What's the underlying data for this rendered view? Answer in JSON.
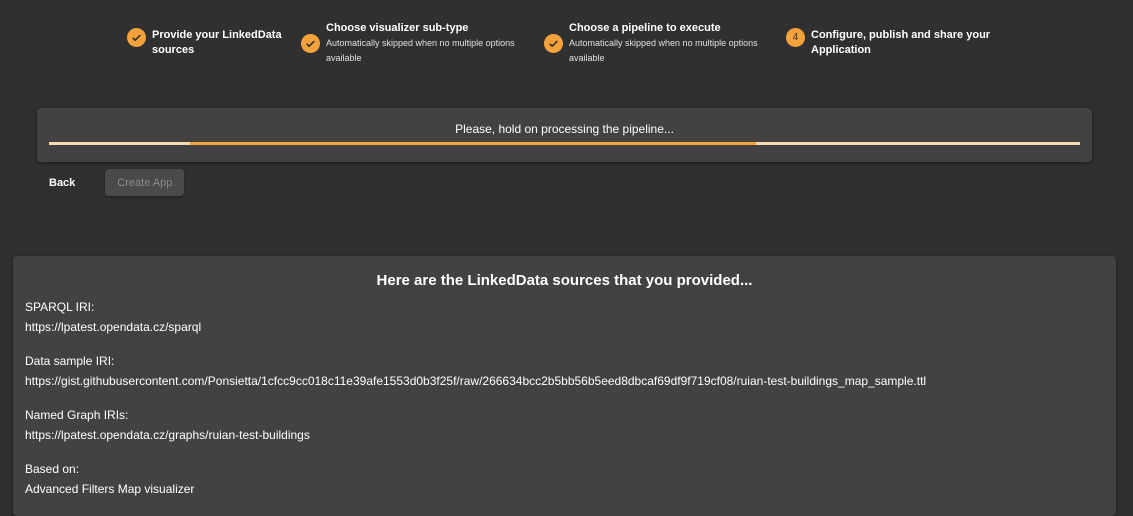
{
  "stepper": {
    "steps": [
      {
        "icon": "check-icon",
        "title_line1": "Provide your LinkedData",
        "title_line2": "sources",
        "sub_line1": "",
        "sub_line2": ""
      },
      {
        "icon": "check-icon",
        "title_line1": "Choose visualizer sub-type",
        "title_line2": "",
        "sub_line1": "Automatically skipped when no multiple options",
        "sub_line2": "available"
      },
      {
        "icon": "check-icon",
        "title_line1": "Choose a pipeline to execute",
        "title_line2": "",
        "sub_line1": "Automatically skipped when no multiple options",
        "sub_line2": "available"
      },
      {
        "icon": "step-number",
        "number": "4",
        "title_line1": "Configure, publish and share your",
        "title_line2": "Application",
        "sub_line1": "",
        "sub_line2": ""
      }
    ]
  },
  "progress": {
    "label": "Please, hold on processing the pipeline...",
    "indeterminate": true,
    "bar_start": 0.137,
    "bar_end": 0.686
  },
  "actions": {
    "back_label": "Back",
    "create_label": "Create App",
    "create_disabled": true
  },
  "sources": {
    "title": "Here are the LinkedData sources that you provided...",
    "fields": [
      {
        "label": "SPARQL IRI:",
        "value": "https://lpatest.opendata.cz/sparql"
      },
      {
        "label": "Data sample IRI:",
        "value": "https://gist.githubusercontent.com/Ponsietta/1cfcc9cc018c11e39afe1553d0b3f25f/raw/266634bcc2b5bb56b5eed8dbcaf69df9f719cf08/ruian-test-buildings_map_sample.ttl"
      },
      {
        "label": "Named Graph IRIs:",
        "value": "https://lpatest.opendata.cz/graphs/ruian-test-buildings"
      },
      {
        "label": "Based on:",
        "value": "Advanced Filters Map visualizer"
      }
    ]
  },
  "colors": {
    "accent": "#f4a33c",
    "background": "#303030",
    "card": "#424242",
    "track": "#f9d9b0"
  }
}
